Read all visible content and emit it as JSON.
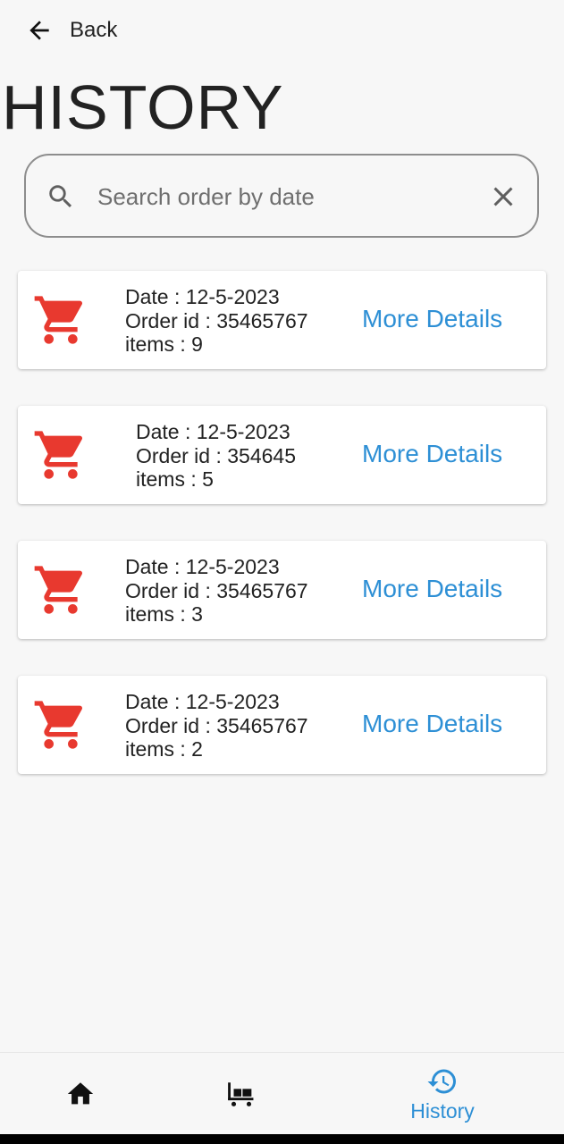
{
  "header": {
    "back_label": "Back",
    "title": "HISTORY"
  },
  "search": {
    "placeholder": "Search order by date",
    "value": ""
  },
  "orders": [
    {
      "date": "Date : 12-5-2023",
      "order_id": "Order id : 35465767",
      "items": "items : 9",
      "action": "More Details"
    },
    {
      "date": "Date : 12-5-2023",
      "order_id": "Order id : 354645",
      "items": "items : 5",
      "action": "More Details"
    },
    {
      "date": "Date : 12-5-2023",
      "order_id": "Order id : 35465767",
      "items": "items : 3",
      "action": "More Details"
    },
    {
      "date": "Date : 12-5-2023",
      "order_id": "Order id : 35465767",
      "items": "items : 2",
      "action": "More Details"
    }
  ],
  "bottom_nav": {
    "items": [
      {
        "icon": "home-icon",
        "label": ""
      },
      {
        "icon": "cart-trolley-icon",
        "label": ""
      },
      {
        "icon": "history-icon",
        "label": "History",
        "active": true
      }
    ]
  },
  "colors": {
    "accent": "#2d8fd5",
    "cart_icon": "#e8392f",
    "background": "#f7f7f7"
  }
}
